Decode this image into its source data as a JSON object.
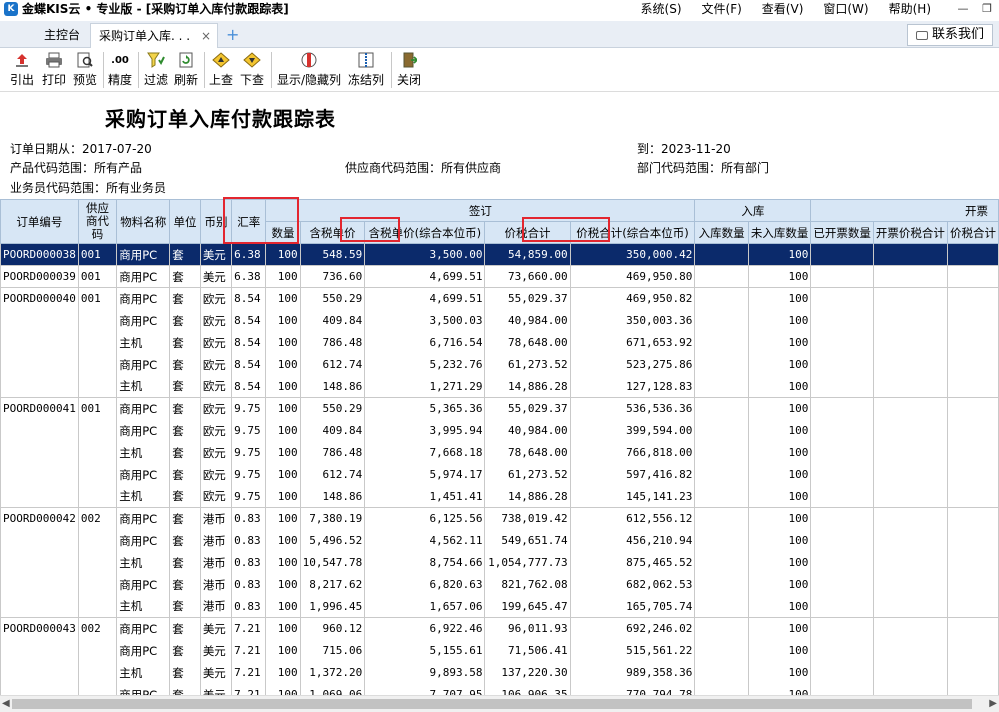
{
  "window": {
    "app_logo": "K",
    "title": "金蝶KIS云 • 专业版 - [采购订单入库付款跟踪表]",
    "menu": [
      "系统(S)",
      "文件(F)",
      "查看(V)",
      "窗口(W)",
      "帮助(H)"
    ]
  },
  "tabs": {
    "home": "主控台",
    "active": "采购订单入库. . .",
    "close": "×",
    "add": "+",
    "contact": "联系我们"
  },
  "toolbar": {
    "buttons": [
      {
        "label": "引出",
        "icon": "export-icon"
      },
      {
        "label": "打印",
        "icon": "print-icon"
      },
      {
        "label": "预览",
        "icon": "preview-icon"
      },
      {
        "label": "精度",
        "icon": "precision-icon",
        "glyph": ".00"
      },
      {
        "label": "过滤",
        "icon": "filter-icon"
      },
      {
        "label": "刷新",
        "icon": "refresh-icon"
      },
      {
        "label": "上查",
        "icon": "query-up-icon"
      },
      {
        "label": "下查",
        "icon": "query-down-icon"
      },
      {
        "label": "显示/隐藏列",
        "icon": "show-hide-columns-icon"
      },
      {
        "label": "冻结列",
        "icon": "freeze-columns-icon"
      },
      {
        "label": "关闭",
        "icon": "close-door-icon"
      }
    ]
  },
  "report": {
    "title": "采购订单入库付款跟踪表",
    "date_from": "订单日期从：2017-07-20",
    "date_to": "到：2023-11-20",
    "product_range": "产品代码范围：所有产品",
    "supplier_range": "供应商代码范围：所有供应商",
    "dept_range": "部门代码范围：所有部门",
    "salesman_range": "业务员代码范围：所有业务员"
  },
  "table": {
    "group_headers": {
      "sign": "签订",
      "inbound": "入库",
      "invoice": "开票"
    },
    "columns": [
      "订单编号",
      "供应商代码",
      "物料名称",
      "单位",
      "币别",
      "汇率",
      "数量",
      "含税单价",
      "含税单价(综合本位币)",
      "价税合计",
      "价税合计(综合本位币)",
      "入库数量",
      "未入库数量",
      "已开票数量",
      "开票价税合计",
      "价税合计"
    ],
    "rows": [
      {
        "order": "POORD000038",
        "supplier": "001",
        "item": "商用PC",
        "unit": "套",
        "currency": "美元",
        "rate": "6.38",
        "qty": "100",
        "price": "548.59",
        "price_base": "3,500.00",
        "total": "54,859.00",
        "total_base": "350,000.42",
        "in_qty": "",
        "not_in": "100",
        "selected": true,
        "group_end": true
      },
      {
        "order": "POORD000039",
        "supplier": "001",
        "item": "商用PC",
        "unit": "套",
        "currency": "美元",
        "rate": "6.38",
        "qty": "100",
        "price": "736.60",
        "price_base": "4,699.51",
        "total": "73,660.00",
        "total_base": "469,950.80",
        "in_qty": "",
        "not_in": "100",
        "group_end": true
      },
      {
        "order": "POORD000040",
        "supplier": "001",
        "item": "商用PC",
        "unit": "套",
        "currency": "欧元",
        "rate": "8.54",
        "qty": "100",
        "price": "550.29",
        "price_base": "4,699.51",
        "total": "55,029.37",
        "total_base": "469,950.82",
        "in_qty": "",
        "not_in": "100"
      },
      {
        "order": "",
        "supplier": "",
        "item": "商用PC",
        "unit": "套",
        "currency": "欧元",
        "rate": "8.54",
        "qty": "100",
        "price": "409.84",
        "price_base": "3,500.03",
        "total": "40,984.00",
        "total_base": "350,003.36",
        "in_qty": "",
        "not_in": "100"
      },
      {
        "order": "",
        "supplier": "",
        "item": "主机",
        "unit": "套",
        "currency": "欧元",
        "rate": "8.54",
        "qty": "100",
        "price": "786.48",
        "price_base": "6,716.54",
        "total": "78,648.00",
        "total_base": "671,653.92",
        "in_qty": "",
        "not_in": "100"
      },
      {
        "order": "",
        "supplier": "",
        "item": "商用PC",
        "unit": "套",
        "currency": "欧元",
        "rate": "8.54",
        "qty": "100",
        "price": "612.74",
        "price_base": "5,232.76",
        "total": "61,273.52",
        "total_base": "523,275.86",
        "in_qty": "",
        "not_in": "100"
      },
      {
        "order": "",
        "supplier": "",
        "item": "主机",
        "unit": "套",
        "currency": "欧元",
        "rate": "8.54",
        "qty": "100",
        "price": "148.86",
        "price_base": "1,271.29",
        "total": "14,886.28",
        "total_base": "127,128.83",
        "in_qty": "",
        "not_in": "100",
        "group_end": true
      },
      {
        "order": "POORD000041",
        "supplier": "001",
        "item": "商用PC",
        "unit": "套",
        "currency": "欧元",
        "rate": "9.75",
        "qty": "100",
        "price": "550.29",
        "price_base": "5,365.36",
        "total": "55,029.37",
        "total_base": "536,536.36",
        "in_qty": "",
        "not_in": "100"
      },
      {
        "order": "",
        "supplier": "",
        "item": "商用PC",
        "unit": "套",
        "currency": "欧元",
        "rate": "9.75",
        "qty": "100",
        "price": "409.84",
        "price_base": "3,995.94",
        "total": "40,984.00",
        "total_base": "399,594.00",
        "in_qty": "",
        "not_in": "100"
      },
      {
        "order": "",
        "supplier": "",
        "item": "主机",
        "unit": "套",
        "currency": "欧元",
        "rate": "9.75",
        "qty": "100",
        "price": "786.48",
        "price_base": "7,668.18",
        "total": "78,648.00",
        "total_base": "766,818.00",
        "in_qty": "",
        "not_in": "100"
      },
      {
        "order": "",
        "supplier": "",
        "item": "商用PC",
        "unit": "套",
        "currency": "欧元",
        "rate": "9.75",
        "qty": "100",
        "price": "612.74",
        "price_base": "5,974.17",
        "total": "61,273.52",
        "total_base": "597,416.82",
        "in_qty": "",
        "not_in": "100"
      },
      {
        "order": "",
        "supplier": "",
        "item": "主机",
        "unit": "套",
        "currency": "欧元",
        "rate": "9.75",
        "qty": "100",
        "price": "148.86",
        "price_base": "1,451.41",
        "total": "14,886.28",
        "total_base": "145,141.23",
        "in_qty": "",
        "not_in": "100",
        "group_end": true
      },
      {
        "order": "POORD000042",
        "supplier": "002",
        "item": "商用PC",
        "unit": "套",
        "currency": "港币",
        "rate": "0.83",
        "qty": "100",
        "price": "7,380.19",
        "price_base": "6,125.56",
        "total": "738,019.42",
        "total_base": "612,556.12",
        "in_qty": "",
        "not_in": "100"
      },
      {
        "order": "",
        "supplier": "",
        "item": "商用PC",
        "unit": "套",
        "currency": "港币",
        "rate": "0.83",
        "qty": "100",
        "price": "5,496.52",
        "price_base": "4,562.11",
        "total": "549,651.74",
        "total_base": "456,210.94",
        "in_qty": "",
        "not_in": "100"
      },
      {
        "order": "",
        "supplier": "",
        "item": "主机",
        "unit": "套",
        "currency": "港币",
        "rate": "0.83",
        "qty": "100",
        "price": "10,547.78",
        "price_base": "8,754.66",
        "total": "1,054,777.73",
        "total_base": "875,465.52",
        "in_qty": "",
        "not_in": "100"
      },
      {
        "order": "",
        "supplier": "",
        "item": "商用PC",
        "unit": "套",
        "currency": "港币",
        "rate": "0.83",
        "qty": "100",
        "price": "8,217.62",
        "price_base": "6,820.63",
        "total": "821,762.08",
        "total_base": "682,062.53",
        "in_qty": "",
        "not_in": "100"
      },
      {
        "order": "",
        "supplier": "",
        "item": "主机",
        "unit": "套",
        "currency": "港币",
        "rate": "0.83",
        "qty": "100",
        "price": "1,996.45",
        "price_base": "1,657.06",
        "total": "199,645.47",
        "total_base": "165,705.74",
        "in_qty": "",
        "not_in": "100",
        "group_end": true
      },
      {
        "order": "POORD000043",
        "supplier": "002",
        "item": "商用PC",
        "unit": "套",
        "currency": "美元",
        "rate": "7.21",
        "qty": "100",
        "price": "960.12",
        "price_base": "6,922.46",
        "total": "96,011.93",
        "total_base": "692,246.02",
        "in_qty": "",
        "not_in": "100"
      },
      {
        "order": "",
        "supplier": "",
        "item": "商用PC",
        "unit": "套",
        "currency": "美元",
        "rate": "7.21",
        "qty": "100",
        "price": "715.06",
        "price_base": "5,155.61",
        "total": "71,506.41",
        "total_base": "515,561.22",
        "in_qty": "",
        "not_in": "100"
      },
      {
        "order": "",
        "supplier": "",
        "item": "主机",
        "unit": "套",
        "currency": "美元",
        "rate": "7.21",
        "qty": "100",
        "price": "1,372.20",
        "price_base": "9,893.58",
        "total": "137,220.30",
        "total_base": "989,358.36",
        "in_qty": "",
        "not_in": "100"
      },
      {
        "order": "",
        "supplier": "",
        "item": "商用PC",
        "unit": "套",
        "currency": "美元",
        "rate": "7.21",
        "qty": "100",
        "price": "1,069.06",
        "price_base": "7,707.95",
        "total": "106,906.35",
        "total_base": "770,794.78",
        "in_qty": "",
        "not_in": "100"
      }
    ]
  },
  "colors": {
    "header_bg": "#d7e6f5",
    "selected_row": "#0b2a6b",
    "highlight_box": "#e3262f"
  }
}
